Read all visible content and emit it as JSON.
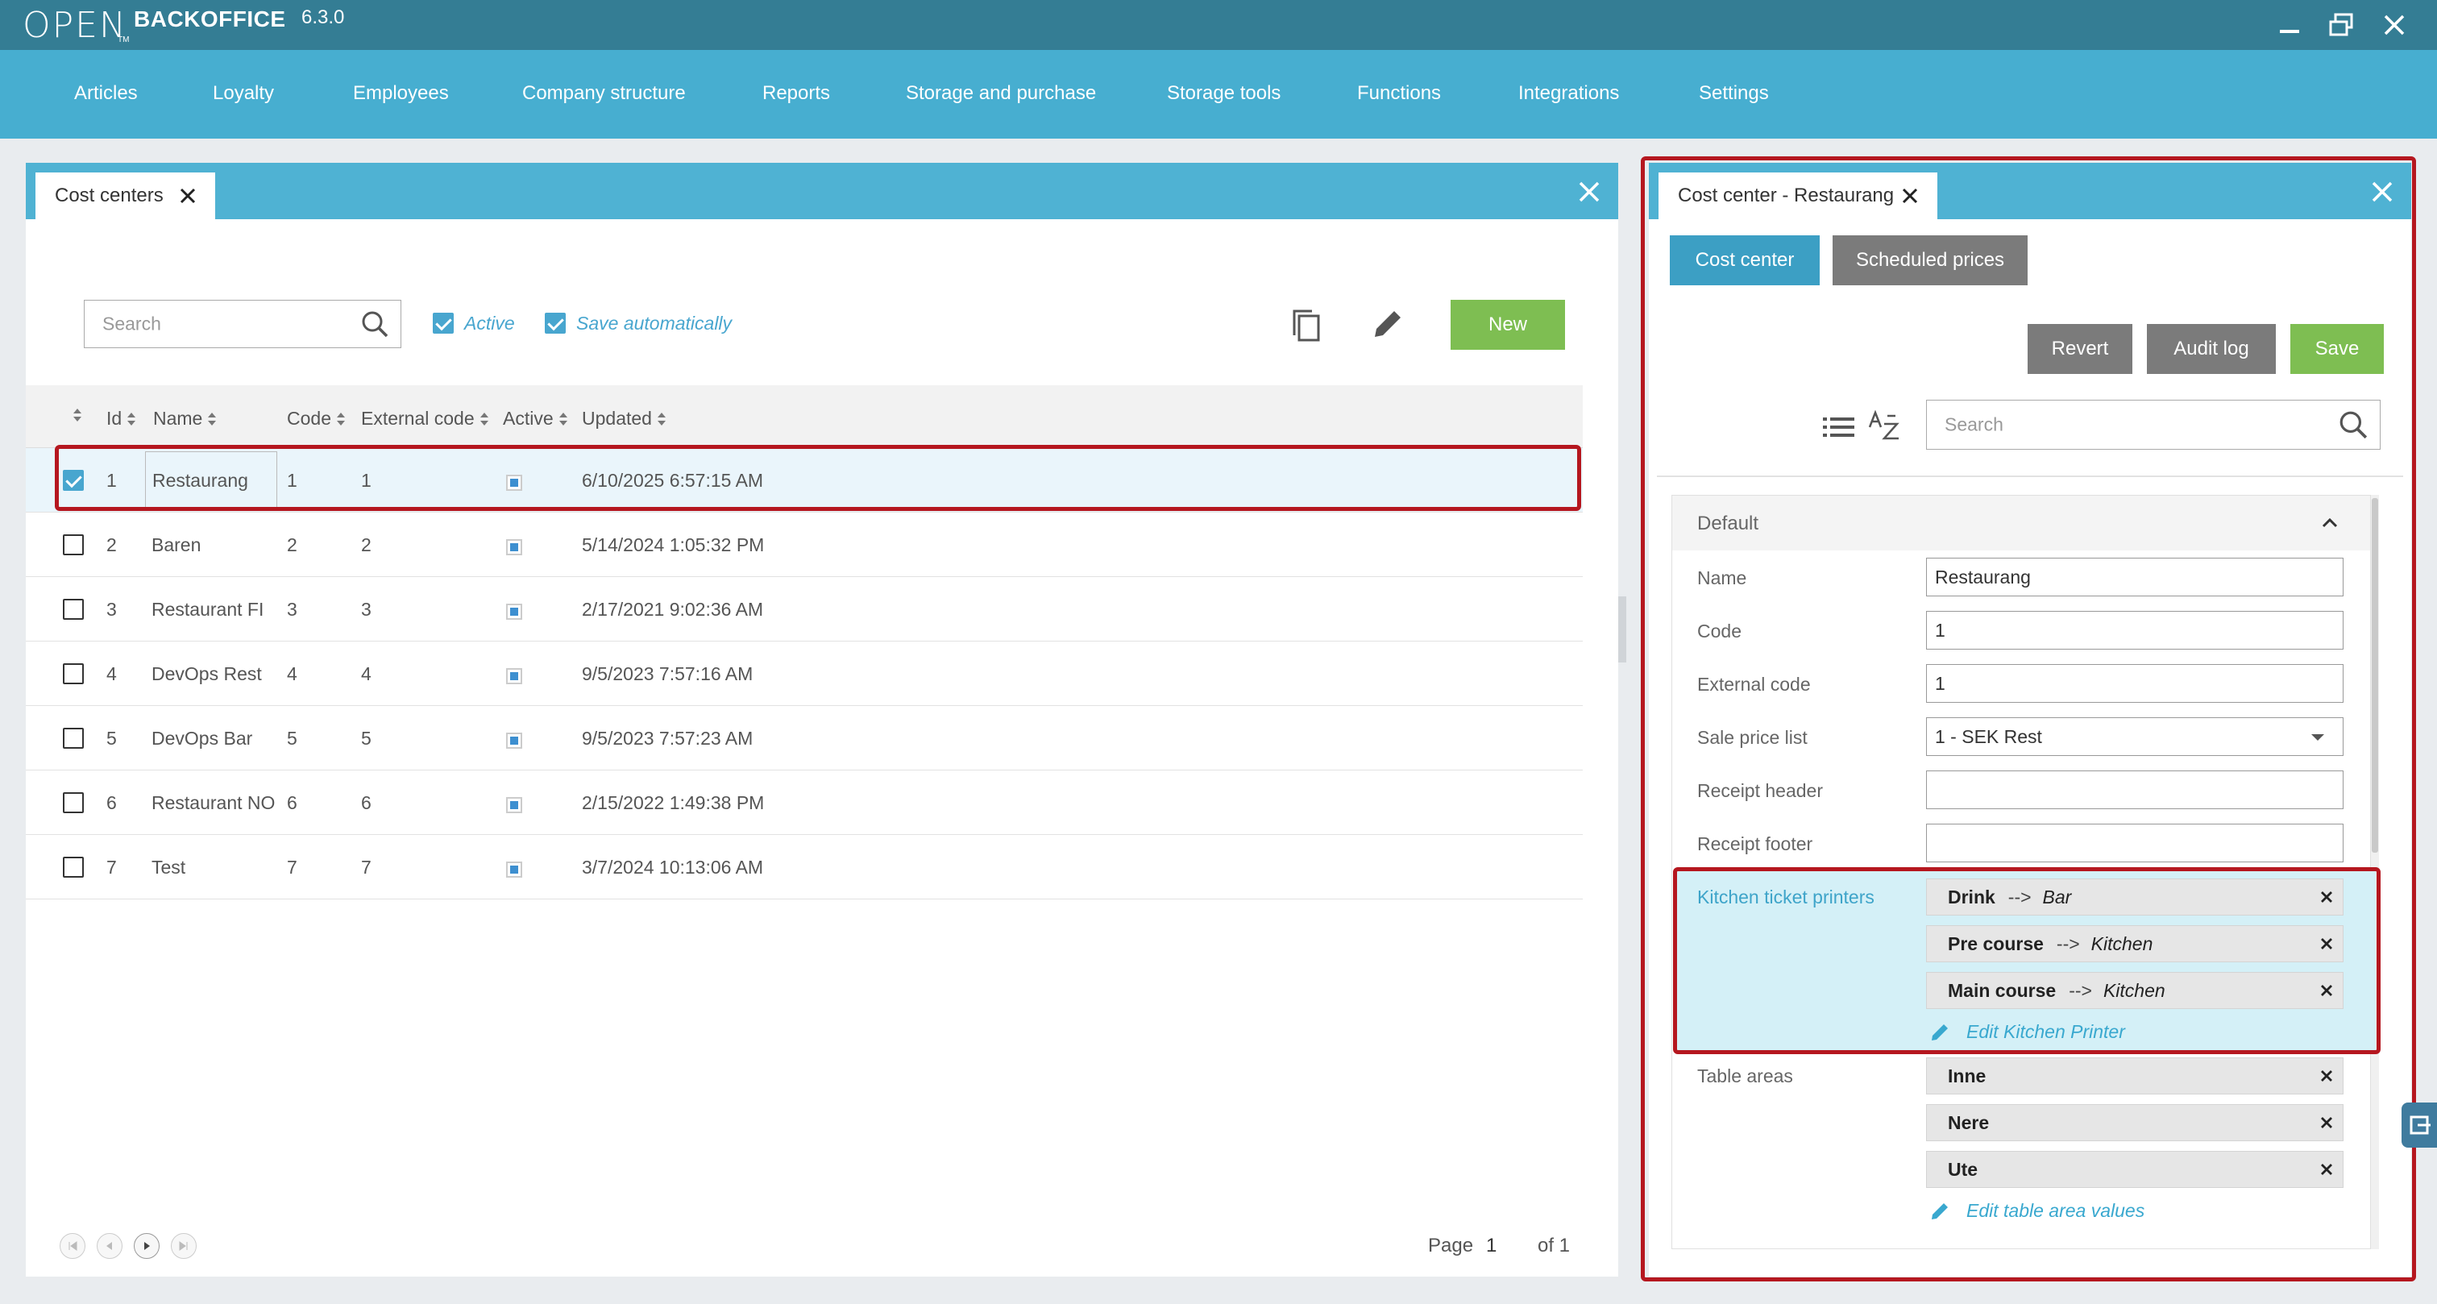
{
  "app": {
    "logo": "OPEN",
    "logo_tm": "TM",
    "brand": "BACKOFFICE",
    "version": "6.3.0"
  },
  "menu": [
    "Articles",
    "Loyalty",
    "Employees",
    "Company structure",
    "Reports",
    "Storage and purchase",
    "Storage tools",
    "Functions",
    "Integrations",
    "Settings"
  ],
  "left": {
    "tab_label": "Cost centers",
    "search_placeholder": "Search",
    "active_label": "Active",
    "save_auto_label": "Save automatically",
    "new_label": "New",
    "columns": [
      "Id",
      "Name",
      "Code",
      "External code",
      "Active",
      "Updated"
    ],
    "rows": [
      {
        "id": "1",
        "name": "Restaurang",
        "code": "1",
        "ext": "1",
        "updated": "6/10/2025 6:57:15 AM",
        "selected": true
      },
      {
        "id": "2",
        "name": "Baren",
        "code": "2",
        "ext": "2",
        "updated": "5/14/2024 1:05:32 PM",
        "selected": false
      },
      {
        "id": "3",
        "name": "Restaurant FI",
        "code": "3",
        "ext": "3",
        "updated": "2/17/2021 9:02:36 AM",
        "selected": false
      },
      {
        "id": "4",
        "name": "DevOps Rest",
        "code": "4",
        "ext": "4",
        "updated": "9/5/2023 7:57:16 AM",
        "selected": false
      },
      {
        "id": "5",
        "name": "DevOps Bar",
        "code": "5",
        "ext": "5",
        "updated": "9/5/2023 7:57:23 AM",
        "selected": false
      },
      {
        "id": "6",
        "name": "Restaurant NO",
        "code": "6",
        "ext": "6",
        "updated": "2/15/2022 1:49:38 PM",
        "selected": false
      },
      {
        "id": "7",
        "name": "Test",
        "code": "7",
        "ext": "7",
        "updated": "3/7/2024 10:13:06 AM",
        "selected": false
      }
    ],
    "pager": {
      "page_label": "Page",
      "page": "1",
      "of_label": "of 1"
    }
  },
  "right": {
    "tab_label": "Cost center - Restaurang",
    "sub_tabs": [
      "Cost center",
      "Scheduled prices"
    ],
    "revert_label": "Revert",
    "audit_label": "Audit log",
    "save_label": "Save",
    "search_placeholder": "Search",
    "section_title": "Default",
    "fields": {
      "name_label": "Name",
      "name_value": "Restaurang",
      "code_label": "Code",
      "code_value": "1",
      "ext_label": "External code",
      "ext_value": "1",
      "price_label": "Sale price list",
      "price_value": "1 - SEK Rest",
      "header_label": "Receipt header",
      "header_value": "",
      "footer_label": "Receipt footer",
      "footer_value": ""
    },
    "kitchen": {
      "label": "Kitchen ticket printers",
      "arrow": "-->",
      "items": [
        {
          "name": "Drink",
          "target": "Bar"
        },
        {
          "name": "Pre course",
          "target": "Kitchen"
        },
        {
          "name": "Main course",
          "target": "Kitchen"
        }
      ],
      "edit_label": "Edit Kitchen Printer"
    },
    "tables": {
      "label": "Table areas",
      "items": [
        "Inne",
        "Nere",
        "Ute"
      ],
      "edit_label": "Edit table area values"
    }
  },
  "colors": {
    "titlebar": "#347d94",
    "menubar": "#47aed0",
    "panel_head": "#4fb2d3",
    "accent": "#48a6cf",
    "green": "#7ebe52",
    "highlight": "#b5171f",
    "kitchen_bg": "#d4f0f7"
  }
}
